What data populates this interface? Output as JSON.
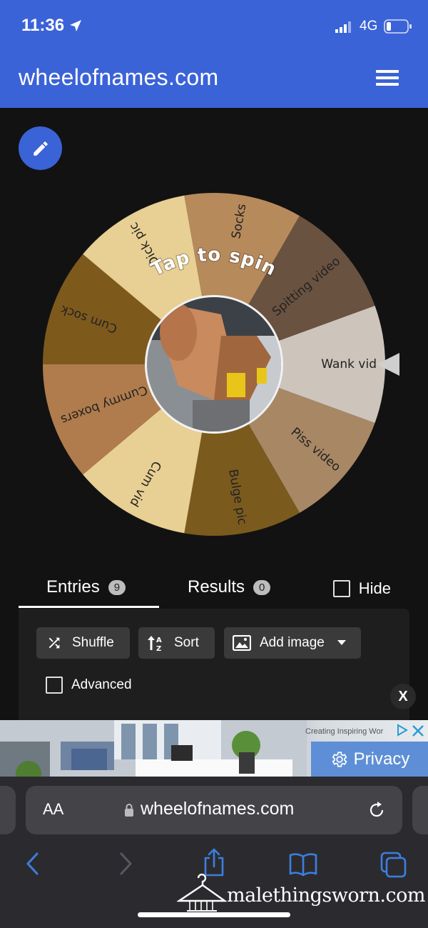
{
  "status_bar": {
    "time": "11:36",
    "network": "4G"
  },
  "header": {
    "title": "wheelofnames.com",
    "menu_icon": "hamburger-menu-icon"
  },
  "edit_button": {
    "icon": "pencil-icon"
  },
  "wheel": {
    "center_prompt": "Tap to spin",
    "pointer_icon": "pointer-triangle-icon",
    "segments": [
      {
        "label": "Wank vid",
        "color": "#cdc4bb"
      },
      {
        "label": "Piss video",
        "color": "#a88764"
      },
      {
        "label": "Bulge pic",
        "color": "#7b5a1d"
      },
      {
        "label": "Cum vid",
        "color": "#e8cf93"
      },
      {
        "label": "Cummy boxers",
        "color": "#b07c4d"
      },
      {
        "label": "Cum sock",
        "color": "#7d5a1c"
      },
      {
        "label": "Dick pic",
        "color": "#e8cf93"
      },
      {
        "label": "Socks",
        "color": "#b78a5c"
      },
      {
        "label": "Spitting video",
        "color": "#6a5240"
      }
    ]
  },
  "tabs": {
    "entries_label": "Entries",
    "entries_count": "9",
    "results_label": "Results",
    "results_count": "0",
    "hide_label": "Hide"
  },
  "toolbar": {
    "shuffle_label": "Shuffle",
    "sort_label": "Sort",
    "add_image_label": "Add image",
    "advanced_label": "Advanced",
    "close_label": "X"
  },
  "ad": {
    "text": "Creating Inspiring Wor",
    "privacy_label": "Privacy"
  },
  "browser": {
    "aa_label": "AA",
    "url": "wheelofnames.com"
  },
  "watermark": {
    "text": "malethingsworn.com"
  }
}
